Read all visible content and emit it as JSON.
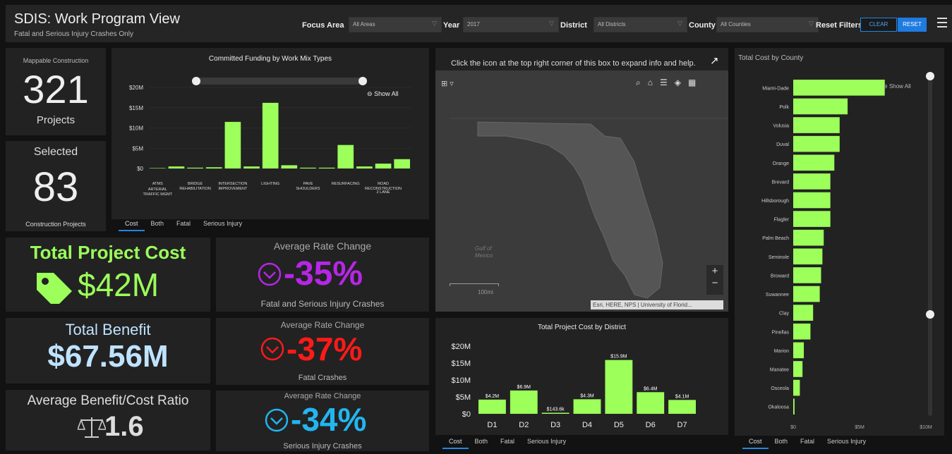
{
  "header": {
    "title": "SDIS: Work Program View",
    "subtitle": "Fatal and Serious Injury Crashes Only"
  },
  "filters": {
    "focus_area_label": "Focus Area",
    "focus_area_value": "All Areas",
    "year_label": "Year",
    "year_value": "2017",
    "district_label": "District",
    "district_value": "All Districts",
    "county_label": "County",
    "county_value": "All Counties",
    "reset_filters_label": "Reset Filters",
    "clear_label": "CLEAR",
    "reset_label": "RESET"
  },
  "stats": {
    "mappable_label": "Mappable Construction",
    "mappable_count": "321",
    "mappable_unit": "Projects",
    "selected_label": "Selected",
    "selected_count": "83",
    "selected_unit": "Construction Projects"
  },
  "kpis": {
    "total_cost_label": "Total Project Cost",
    "total_cost_value": "$42M",
    "total_benefit_label": "Total Benefit",
    "total_benefit_value": "$67.56M",
    "bcr_label": "Average Benefit/Cost Ratio",
    "bcr_value": "1.6",
    "rate1_label": "Average Rate Change",
    "rate1_value": "-35%",
    "rate1_caption": "Fatal and Serious Injury Crashes",
    "rate2_label": "Average Rate Change",
    "rate2_value": "-37%",
    "rate2_caption": "Fatal Crashes",
    "rate3_label": "Average Rate Change",
    "rate3_value": "-34%",
    "rate3_caption": "Serious Injury Crashes"
  },
  "colors": {
    "accent_green": "#9cff5a",
    "purple": "#b626e6",
    "red": "#ff1a1a",
    "cyan": "#22b5f0",
    "benefit_blue": "#bfe3ff",
    "tab_blue": "#1e88e5"
  },
  "tabs": [
    "Cost",
    "Both",
    "Fatal",
    "Serious Injury"
  ],
  "show_all_label": "Show All",
  "map": {
    "help_text": "Click the icon at the top right corner of this box to expand info and help.",
    "gulf_label_1": "Gulf of",
    "gulf_label_2": "Mexico",
    "scale_label": "100mi",
    "attribution": "Esri, HERE, NPS | University of Florid...",
    "zoom_in": "+",
    "zoom_out": "−"
  },
  "chart_data": [
    {
      "type": "bar",
      "title": "Committed Funding by Work Mix Types",
      "categories": [
        "ATMS",
        "ARTERIAL TRAFFIC MGMT",
        "BRIDGE REHABILITATION",
        "",
        "INTERSECTION IMPROVEMENT",
        "",
        "LIGHTING",
        "",
        "PAVE SHOULDERS",
        "",
        "RESURFACING",
        "",
        "ROAD RECONSTRUCTION",
        "2 LANE"
      ],
      "labeled_categories": [
        "ATMS",
        "ARTERIAL TRAFFIC MGMT",
        "BRIDGE REHABILITATION",
        "INTERSECTION IMPROVEMENT",
        "LIGHTING",
        "PAVE SHOULDERS",
        "RESURFACING",
        "ROAD RECONSTRUCTION",
        "2 LANE"
      ],
      "values": [
        0.1,
        0.5,
        0.2,
        0.3,
        11.5,
        0.5,
        16.2,
        0.8,
        0.2,
        0.2,
        5.8,
        0.5,
        1.2,
        2.3
      ],
      "y_ticks": [
        "$0",
        "$5M",
        "$10M",
        "$15M",
        "$20M"
      ],
      "ylim": [
        0,
        20
      ],
      "color": "#9cff5a"
    },
    {
      "type": "bar",
      "title": "Total Project Cost by District",
      "categories": [
        "D1",
        "D2",
        "D3",
        "D4",
        "D5",
        "D6",
        "D7"
      ],
      "values": [
        4.2,
        6.9,
        0.1436,
        4.3,
        15.9,
        6.4,
        4.1
      ],
      "data_labels": [
        "$4.2M",
        "$6.9M",
        "$143.6k",
        "$4.3M",
        "$15.9M",
        "$6.4M",
        "$4.1M"
      ],
      "y_ticks": [
        "$0",
        "$5M",
        "$10M",
        "$15M",
        "$20M"
      ],
      "ylim": [
        0,
        20
      ],
      "color": "#9cff5a"
    },
    {
      "type": "bar",
      "title": "Total Cost by County",
      "orientation": "horizontal",
      "categories": [
        "Miami-Dade",
        "Polk",
        "Volusia",
        "Duval",
        "Orange",
        "Brevard",
        "Hillsborough",
        "Flagler",
        "Palm Beach",
        "Seminole",
        "Broward",
        "Suwannee",
        "Clay",
        "Pinellas",
        "Marion",
        "Manatee",
        "Osceola",
        "Okaloosa"
      ],
      "values": [
        6.9,
        4.1,
        3.5,
        3.5,
        3.1,
        2.8,
        2.8,
        2.8,
        2.3,
        2.2,
        2.1,
        2.0,
        1.5,
        1.3,
        0.8,
        0.7,
        0.5,
        0.1
      ],
      "x_ticks": [
        "$0",
        "$5M",
        "$10M"
      ],
      "xlim": [
        0,
        10
      ],
      "color": "#9cff5a"
    }
  ]
}
